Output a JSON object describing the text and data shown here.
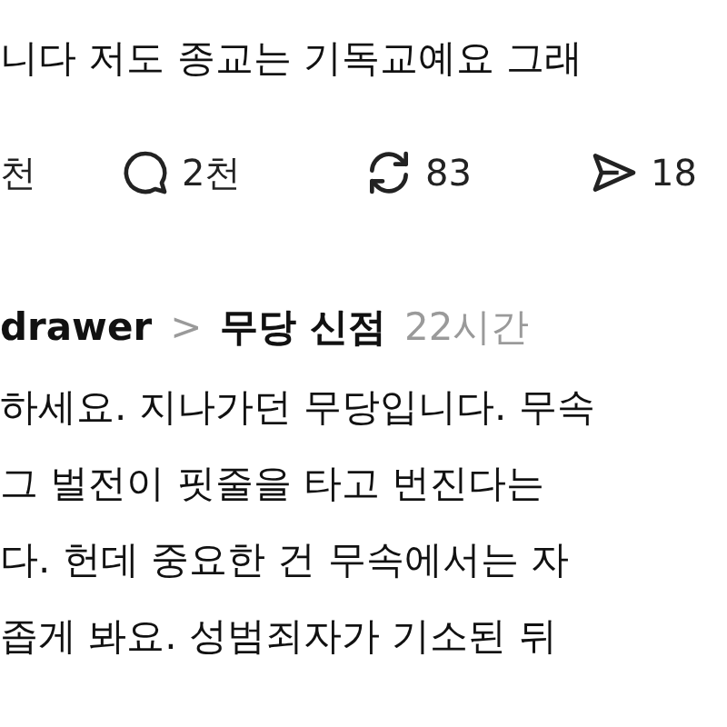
{
  "post": {
    "text": "니다 저도 종교는 기독교예요 그래",
    "actions": [
      {
        "kind": "like",
        "count": "천"
      },
      {
        "kind": "reply",
        "count": "2천"
      },
      {
        "kind": "repost",
        "count": "83"
      },
      {
        "kind": "share",
        "count": "18"
      }
    ]
  },
  "reply": {
    "username": "drawer",
    "separator": ">",
    "topic": "무당 신점",
    "time": "22시간",
    "lines": [
      "하세요. 지나가던 무당입니다. 무속",
      "그 벌전이 핏줄을 타고 번진다는",
      "다. 헌데 중요한 건 무속에서는 자",
      "좁게 봐요. 성범죄자가 기소된 뒤"
    ]
  }
}
